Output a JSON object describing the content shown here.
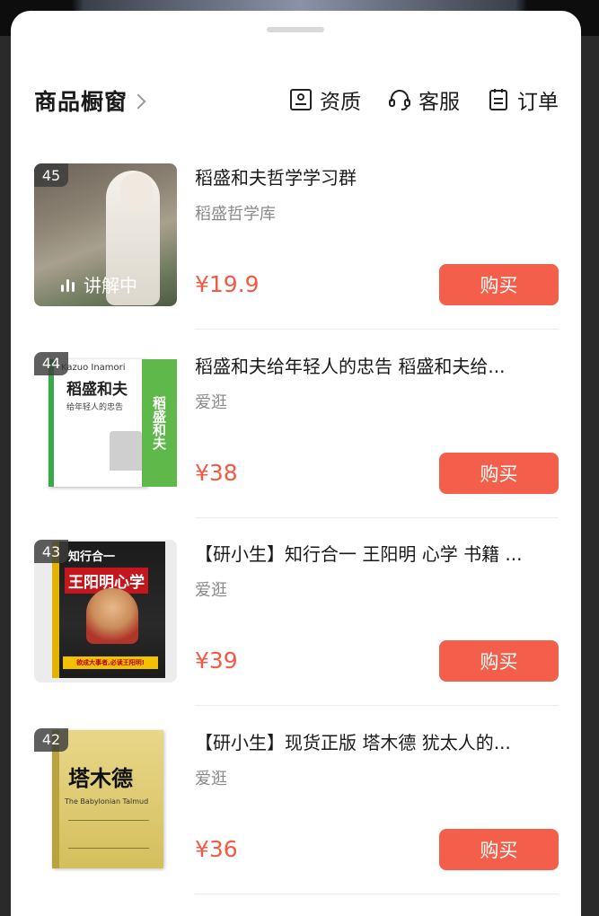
{
  "header": {
    "title": "商品橱窗",
    "actions": [
      {
        "label": "资质",
        "icon": "id-card-icon"
      },
      {
        "label": "客服",
        "icon": "headset-icon"
      },
      {
        "label": "订单",
        "icon": "order-list-icon"
      }
    ]
  },
  "products": [
    {
      "rank": "45",
      "name": "稻盛和夫哲学学习群",
      "shop": "稻盛哲学库",
      "price": "¥19.9",
      "buy": "购买",
      "live": "讲解中"
    },
    {
      "rank": "44",
      "name": "稻盛和夫给年轻人的忠告 稻盛和夫给...",
      "shop": "爱逛",
      "price": "¥38",
      "buy": "购买",
      "cover_brand": "Kazuo Inamori",
      "cover_title": "稻盛和夫",
      "cover_sub": "给年轻人的忠告",
      "cover_side": "稻盛和夫"
    },
    {
      "rank": "43",
      "name": "【研小生】知行合一 王阳明 心学 书籍 ...",
      "shop": "爱逛",
      "price": "¥39",
      "buy": "购买",
      "cover_top": "知行合一",
      "cover_title": "王阳明心学",
      "cover_tag": "欲成大事者,必读王阳明!"
    },
    {
      "rank": "42",
      "name": "【研小生】现货正版 塔木德 犹太人的...",
      "shop": "爱逛",
      "price": "¥36",
      "buy": "购买",
      "cover_title": "塔木德",
      "cover_en": "The Babylonian Talmud"
    }
  ],
  "colors": {
    "accent": "#f35f4a",
    "price": "#f25a45"
  }
}
